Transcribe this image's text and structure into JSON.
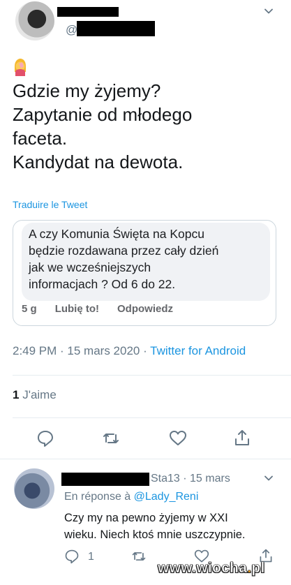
{
  "tweet": {
    "handle_prefix": "@",
    "text_lines": [
      "Gdzie my żyjemy?",
      "Zapytanie od młodego",
      "faceta.",
      "Kandydat na dewota."
    ],
    "translate_label": "Traduire le Tweet",
    "timestamp": "2:49 PM · 15 mars 2020 · ",
    "source": "Twitter for Android",
    "likes_count": "1",
    "likes_label": " J'aime"
  },
  "quoted_comment": {
    "lines": [
      "A czy Komunia Święta na Kopcu",
      "będzie rozdawana przez cały dzień",
      "jak we wcześniejszych",
      "informacjach ? Od 6 do 22."
    ],
    "age": "5 g",
    "like_label": "Lubię to!",
    "reply_label": "Odpowiedz"
  },
  "reply": {
    "name_suffix": "Sta13 · 15 mars",
    "in_reply_prefix": "En réponse à ",
    "in_reply_mention": "@Lady_Reni",
    "text_lines": [
      "Czy my na pewno żyjemy w XXI",
      "wieku. Niech ktoś mnie uszczypnie."
    ],
    "reply_count": "1"
  },
  "watermark": {
    "prefix": "www.",
    "brand": "wiocha",
    "dot": ".",
    "tld": "pl"
  },
  "icons": {
    "emoji": "woman-facepalming-emoji",
    "actions": [
      "reply-icon",
      "retweet-icon",
      "like-icon",
      "share-icon"
    ]
  },
  "colors": {
    "link": "#1b95e0",
    "muted": "#657786",
    "text": "#14171a",
    "divider": "#e6ecf0"
  }
}
